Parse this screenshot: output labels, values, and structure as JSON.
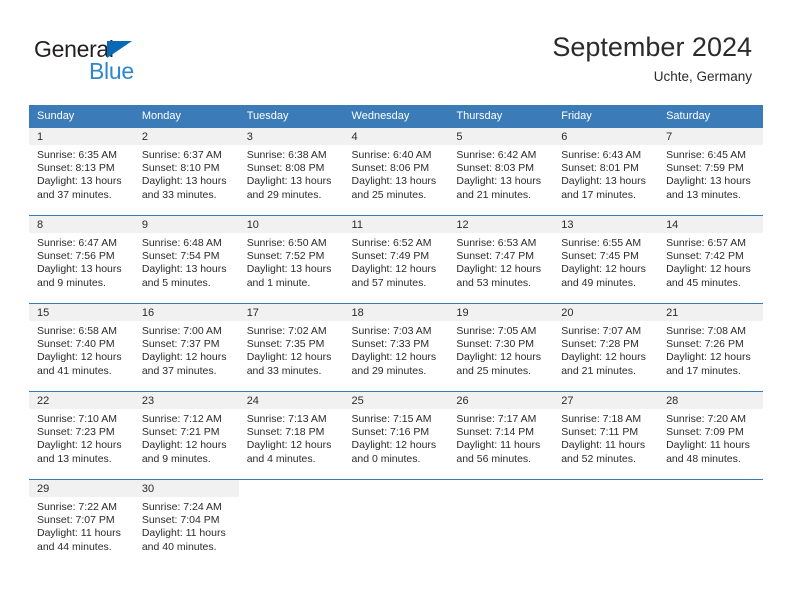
{
  "logo": {
    "word_one": "General",
    "word_two": "Blue",
    "triangle_color": "#0a69b5",
    "blue_text_color": "#2e87cc"
  },
  "header": {
    "title": "September 2024",
    "subtitle": "Uchte, Germany"
  },
  "theme": {
    "header_blue": "#3b7cb8",
    "daynum_band": "#f1f1f1",
    "text": "#2b2b2b"
  },
  "weekday_headers": [
    "Sunday",
    "Monday",
    "Tuesday",
    "Wednesday",
    "Thursday",
    "Friday",
    "Saturday"
  ],
  "weeks": [
    [
      {
        "day": "1",
        "sunrise": "Sunrise: 6:35 AM",
        "sunset": "Sunset: 8:13 PM",
        "daylight_line1": "Daylight: 13 hours",
        "daylight_line2": "and 37 minutes."
      },
      {
        "day": "2",
        "sunrise": "Sunrise: 6:37 AM",
        "sunset": "Sunset: 8:10 PM",
        "daylight_line1": "Daylight: 13 hours",
        "daylight_line2": "and 33 minutes."
      },
      {
        "day": "3",
        "sunrise": "Sunrise: 6:38 AM",
        "sunset": "Sunset: 8:08 PM",
        "daylight_line1": "Daylight: 13 hours",
        "daylight_line2": "and 29 minutes."
      },
      {
        "day": "4",
        "sunrise": "Sunrise: 6:40 AM",
        "sunset": "Sunset: 8:06 PM",
        "daylight_line1": "Daylight: 13 hours",
        "daylight_line2": "and 25 minutes."
      },
      {
        "day": "5",
        "sunrise": "Sunrise: 6:42 AM",
        "sunset": "Sunset: 8:03 PM",
        "daylight_line1": "Daylight: 13 hours",
        "daylight_line2": "and 21 minutes."
      },
      {
        "day": "6",
        "sunrise": "Sunrise: 6:43 AM",
        "sunset": "Sunset: 8:01 PM",
        "daylight_line1": "Daylight: 13 hours",
        "daylight_line2": "and 17 minutes."
      },
      {
        "day": "7",
        "sunrise": "Sunrise: 6:45 AM",
        "sunset": "Sunset: 7:59 PM",
        "daylight_line1": "Daylight: 13 hours",
        "daylight_line2": "and 13 minutes."
      }
    ],
    [
      {
        "day": "8",
        "sunrise": "Sunrise: 6:47 AM",
        "sunset": "Sunset: 7:56 PM",
        "daylight_line1": "Daylight: 13 hours",
        "daylight_line2": "and 9 minutes."
      },
      {
        "day": "9",
        "sunrise": "Sunrise: 6:48 AM",
        "sunset": "Sunset: 7:54 PM",
        "daylight_line1": "Daylight: 13 hours",
        "daylight_line2": "and 5 minutes."
      },
      {
        "day": "10",
        "sunrise": "Sunrise: 6:50 AM",
        "sunset": "Sunset: 7:52 PM",
        "daylight_line1": "Daylight: 13 hours",
        "daylight_line2": "and 1 minute."
      },
      {
        "day": "11",
        "sunrise": "Sunrise: 6:52 AM",
        "sunset": "Sunset: 7:49 PM",
        "daylight_line1": "Daylight: 12 hours",
        "daylight_line2": "and 57 minutes."
      },
      {
        "day": "12",
        "sunrise": "Sunrise: 6:53 AM",
        "sunset": "Sunset: 7:47 PM",
        "daylight_line1": "Daylight: 12 hours",
        "daylight_line2": "and 53 minutes."
      },
      {
        "day": "13",
        "sunrise": "Sunrise: 6:55 AM",
        "sunset": "Sunset: 7:45 PM",
        "daylight_line1": "Daylight: 12 hours",
        "daylight_line2": "and 49 minutes."
      },
      {
        "day": "14",
        "sunrise": "Sunrise: 6:57 AM",
        "sunset": "Sunset: 7:42 PM",
        "daylight_line1": "Daylight: 12 hours",
        "daylight_line2": "and 45 minutes."
      }
    ],
    [
      {
        "day": "15",
        "sunrise": "Sunrise: 6:58 AM",
        "sunset": "Sunset: 7:40 PM",
        "daylight_line1": "Daylight: 12 hours",
        "daylight_line2": "and 41 minutes."
      },
      {
        "day": "16",
        "sunrise": "Sunrise: 7:00 AM",
        "sunset": "Sunset: 7:37 PM",
        "daylight_line1": "Daylight: 12 hours",
        "daylight_line2": "and 37 minutes."
      },
      {
        "day": "17",
        "sunrise": "Sunrise: 7:02 AM",
        "sunset": "Sunset: 7:35 PM",
        "daylight_line1": "Daylight: 12 hours",
        "daylight_line2": "and 33 minutes."
      },
      {
        "day": "18",
        "sunrise": "Sunrise: 7:03 AM",
        "sunset": "Sunset: 7:33 PM",
        "daylight_line1": "Daylight: 12 hours",
        "daylight_line2": "and 29 minutes."
      },
      {
        "day": "19",
        "sunrise": "Sunrise: 7:05 AM",
        "sunset": "Sunset: 7:30 PM",
        "daylight_line1": "Daylight: 12 hours",
        "daylight_line2": "and 25 minutes."
      },
      {
        "day": "20",
        "sunrise": "Sunrise: 7:07 AM",
        "sunset": "Sunset: 7:28 PM",
        "daylight_line1": "Daylight: 12 hours",
        "daylight_line2": "and 21 minutes."
      },
      {
        "day": "21",
        "sunrise": "Sunrise: 7:08 AM",
        "sunset": "Sunset: 7:26 PM",
        "daylight_line1": "Daylight: 12 hours",
        "daylight_line2": "and 17 minutes."
      }
    ],
    [
      {
        "day": "22",
        "sunrise": "Sunrise: 7:10 AM",
        "sunset": "Sunset: 7:23 PM",
        "daylight_line1": "Daylight: 12 hours",
        "daylight_line2": "and 13 minutes."
      },
      {
        "day": "23",
        "sunrise": "Sunrise: 7:12 AM",
        "sunset": "Sunset: 7:21 PM",
        "daylight_line1": "Daylight: 12 hours",
        "daylight_line2": "and 9 minutes."
      },
      {
        "day": "24",
        "sunrise": "Sunrise: 7:13 AM",
        "sunset": "Sunset: 7:18 PM",
        "daylight_line1": "Daylight: 12 hours",
        "daylight_line2": "and 4 minutes."
      },
      {
        "day": "25",
        "sunrise": "Sunrise: 7:15 AM",
        "sunset": "Sunset: 7:16 PM",
        "daylight_line1": "Daylight: 12 hours",
        "daylight_line2": "and 0 minutes."
      },
      {
        "day": "26",
        "sunrise": "Sunrise: 7:17 AM",
        "sunset": "Sunset: 7:14 PM",
        "daylight_line1": "Daylight: 11 hours",
        "daylight_line2": "and 56 minutes."
      },
      {
        "day": "27",
        "sunrise": "Sunrise: 7:18 AM",
        "sunset": "Sunset: 7:11 PM",
        "daylight_line1": "Daylight: 11 hours",
        "daylight_line2": "and 52 minutes."
      },
      {
        "day": "28",
        "sunrise": "Sunrise: 7:20 AM",
        "sunset": "Sunset: 7:09 PM",
        "daylight_line1": "Daylight: 11 hours",
        "daylight_line2": "and 48 minutes."
      }
    ],
    [
      {
        "day": "29",
        "sunrise": "Sunrise: 7:22 AM",
        "sunset": "Sunset: 7:07 PM",
        "daylight_line1": "Daylight: 11 hours",
        "daylight_line2": "and 44 minutes."
      },
      {
        "day": "30",
        "sunrise": "Sunrise: 7:24 AM",
        "sunset": "Sunset: 7:04 PM",
        "daylight_line1": "Daylight: 11 hours",
        "daylight_line2": "and 40 minutes."
      },
      {
        "day": "",
        "sunrise": "",
        "sunset": "",
        "daylight_line1": "",
        "daylight_line2": ""
      },
      {
        "day": "",
        "sunrise": "",
        "sunset": "",
        "daylight_line1": "",
        "daylight_line2": ""
      },
      {
        "day": "",
        "sunrise": "",
        "sunset": "",
        "daylight_line1": "",
        "daylight_line2": ""
      },
      {
        "day": "",
        "sunrise": "",
        "sunset": "",
        "daylight_line1": "",
        "daylight_line2": ""
      },
      {
        "day": "",
        "sunrise": "",
        "sunset": "",
        "daylight_line1": "",
        "daylight_line2": ""
      }
    ]
  ]
}
